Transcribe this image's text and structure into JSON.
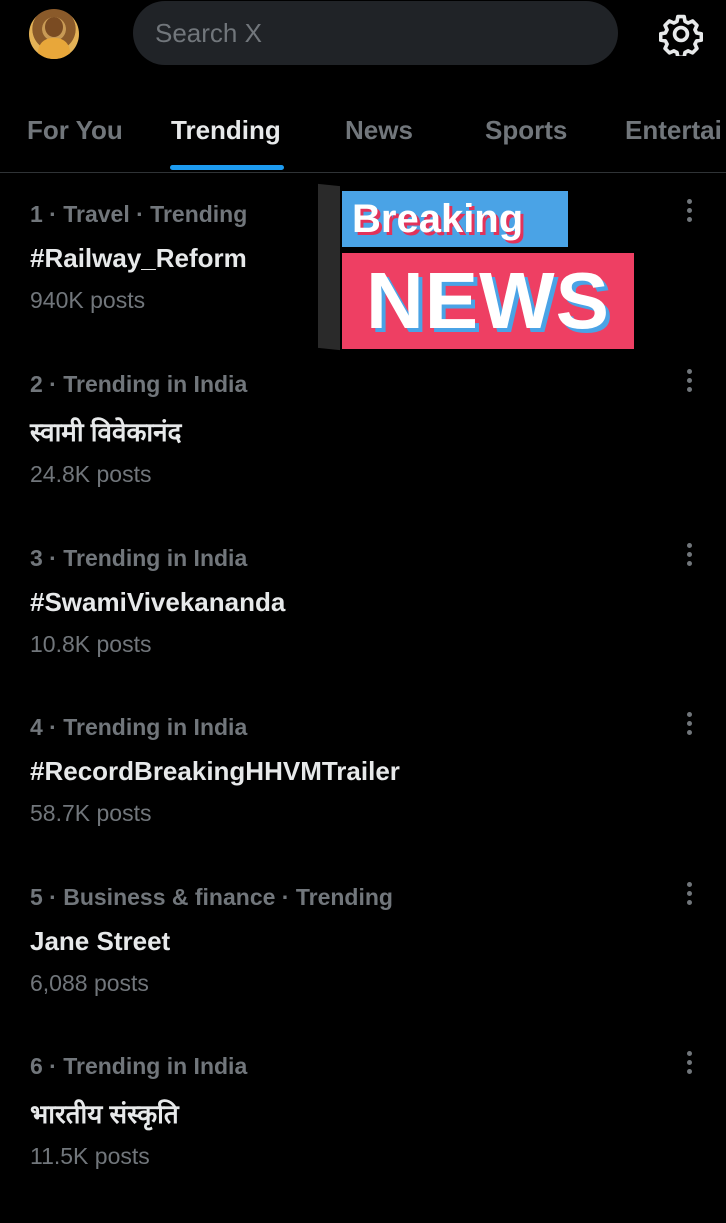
{
  "header": {
    "search_placeholder": "Search X"
  },
  "tabs": [
    {
      "label": "For You"
    },
    {
      "label": "Trending"
    },
    {
      "label": "News"
    },
    {
      "label": "Sports"
    },
    {
      "label": "Entertai"
    }
  ],
  "active_tab": "Trending",
  "banner": {
    "top": "Breaking",
    "bottom": "NEWS"
  },
  "trends": [
    {
      "meta": "1 · Travel · Trending",
      "name": "#Railway_Reform",
      "count": "940K posts"
    },
    {
      "meta": "2 · Trending in India",
      "name": "स्वामी विवेकानंद",
      "count": "24.8K posts"
    },
    {
      "meta": "3 · Trending in India",
      "name": "#SwamiVivekananda",
      "count": "10.8K posts"
    },
    {
      "meta": "4 · Trending in India",
      "name": "#RecordBreakingHHVMTrailer",
      "count": "58.7K posts"
    },
    {
      "meta": "5 · Business & finance · Trending",
      "name": "Jane Street",
      "count": "6,088 posts"
    },
    {
      "meta": "6 · Trending in India",
      "name": "भारतीय संस्कृति",
      "count": "11.5K posts"
    }
  ],
  "colors": {
    "background": "#000000",
    "accent": "#1d9bf0",
    "muted": "#71767b",
    "text": "#e7e9ea"
  }
}
